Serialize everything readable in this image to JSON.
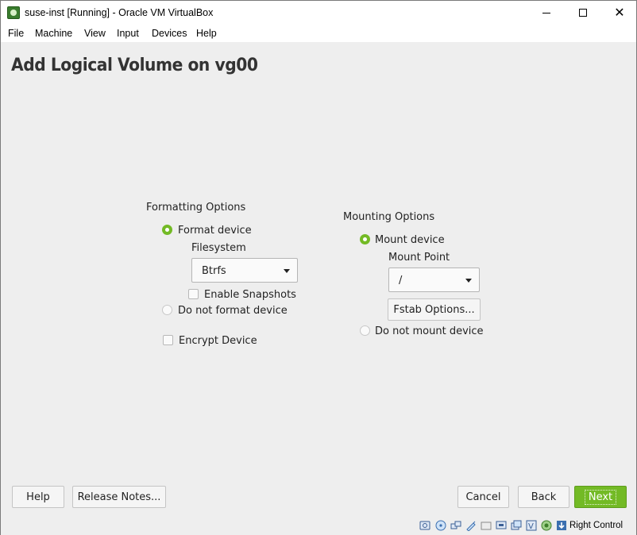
{
  "window": {
    "title": "suse-inst [Running] - Oracle VM VirtualBox"
  },
  "menubar": {
    "items": [
      "File",
      "Machine",
      "View",
      "Input",
      "Devices",
      "Help"
    ]
  },
  "page": {
    "title": "Add Logical Volume on vg00"
  },
  "formatting": {
    "heading": "Formatting Options",
    "format_device_label": "Format device",
    "format_device_selected": true,
    "filesystem_label": "Filesystem",
    "filesystem_value": "Btrfs",
    "enable_snapshots_label": "Enable Snapshots",
    "enable_snapshots_checked": false,
    "do_not_format_label": "Do not format device",
    "do_not_format_selected": false,
    "encrypt_label": "Encrypt Device",
    "encrypt_checked": false
  },
  "mounting": {
    "heading": "Mounting Options",
    "mount_device_label": "Mount device",
    "mount_device_selected": true,
    "mount_point_label": "Mount Point",
    "mount_point_value": "/",
    "fstab_button_label": "Fstab Options...",
    "do_not_mount_label": "Do not mount device",
    "do_not_mount_selected": false
  },
  "buttons": {
    "help": "Help",
    "release_notes": "Release Notes...",
    "cancel": "Cancel",
    "back": "Back",
    "next": "Next"
  },
  "statusbar": {
    "host_key": "Right Control",
    "icons": [
      "hard-disk-icon",
      "optical-drive-icon",
      "network-icon",
      "usb-icon",
      "shared-folder-icon",
      "display-icon",
      "video-capture-icon",
      "virtualization-icon",
      "guest-additions-icon",
      "keyboard-capture-icon"
    ]
  },
  "colors": {
    "accent": "#73ba25"
  }
}
